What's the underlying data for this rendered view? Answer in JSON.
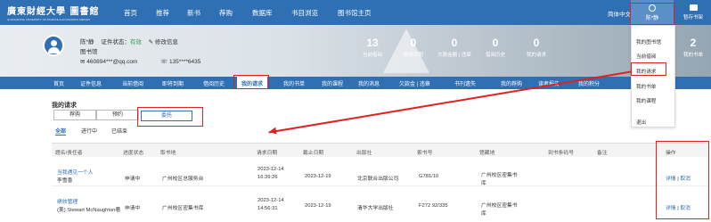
{
  "header": {
    "logo_title": "廣東財經大學 圖書館",
    "logo_subtitle": "GUANGDONG UNIVERSITY OF FINANCE & ECONOMICS LIBRARY",
    "nav": [
      "首页",
      "推荐",
      "新书",
      "荐购",
      "数据库",
      "书目浏览",
      "图书馆主页"
    ],
    "language": "简体中文",
    "user_name": "陈*静",
    "notes_count": "2",
    "notes_label": "暂存书架"
  },
  "profile": {
    "name": "陈*静",
    "cert_label": "证件状态：",
    "cert_status": "有效",
    "edit_label": "修改信息",
    "role": "图书馆",
    "email": "460894***@qq.com",
    "phone": "135****6435",
    "stats": [
      {
        "value": "13",
        "label": "当前借阅"
      },
      {
        "value": "0",
        "label": "即将到期"
      },
      {
        "value": "0",
        "label": "欠款金额 | 违章"
      },
      {
        "value": "0",
        "label": "借阅历史"
      },
      {
        "value": "0",
        "label": "我的请求"
      },
      {
        "value": "2",
        "label": "我的书单"
      }
    ]
  },
  "subnav": [
    "首页",
    "证件信息",
    "当前借阅",
    "即将到期",
    "借阅历史",
    "我的请求",
    "我的书单",
    "我的课程",
    "我的消息",
    "欠款金 | 违章",
    "书刊遗失",
    "我的荐购",
    "读者报告",
    "我的积分"
  ],
  "page": {
    "title": "我的请求",
    "big_tabs": [
      "荐购",
      "预约",
      "委托"
    ],
    "filter_tabs": [
      "全部",
      "进行中",
      "已结束"
    ]
  },
  "table": {
    "columns": [
      "题名/责任者",
      "进度状态",
      "取书地",
      "请求日期",
      "截止日期",
      "出版社",
      "索书号",
      "馆藏地",
      "到书条码号",
      "备注",
      "操作"
    ],
    "rows": [
      {
        "title": "当我遇见一个人",
        "author": "李雪香",
        "status": "申请中",
        "pickup": "广州校区总服务台",
        "req_date": "2023-12-14",
        "req_time": "16:39:26",
        "due_date": "2023-12-19",
        "publisher": "北京联合出版公司",
        "call_no": "G781/10",
        "loc_1": "广州校区密集书",
        "loc_2": "库",
        "barcode": "",
        "note": "",
        "action_detail": "详情",
        "action_cancel": "取消"
      },
      {
        "title": "绩效管理",
        "author": "(美) Stewart McNaughton著",
        "status": "申请中",
        "pickup": "广州校区密集书库",
        "req_date": "2023-12-14",
        "req_time": "14:56:31",
        "due_date": "2023-12-19",
        "publisher": "清华大学出版社",
        "call_no": "F272 92/335",
        "loc_1": "广州校区密集书",
        "loc_2": "库",
        "barcode": "",
        "note": "",
        "action_detail": "详情",
        "action_cancel": "取消"
      }
    ]
  },
  "user_menu": [
    "我的图书馆",
    "当前借阅",
    "我的请求",
    "我的书单",
    "我的课程",
    "退出"
  ],
  "colors": {
    "brand": "#2f6fb3",
    "highlight": "#e12020",
    "valid": "#2e9e4a"
  }
}
